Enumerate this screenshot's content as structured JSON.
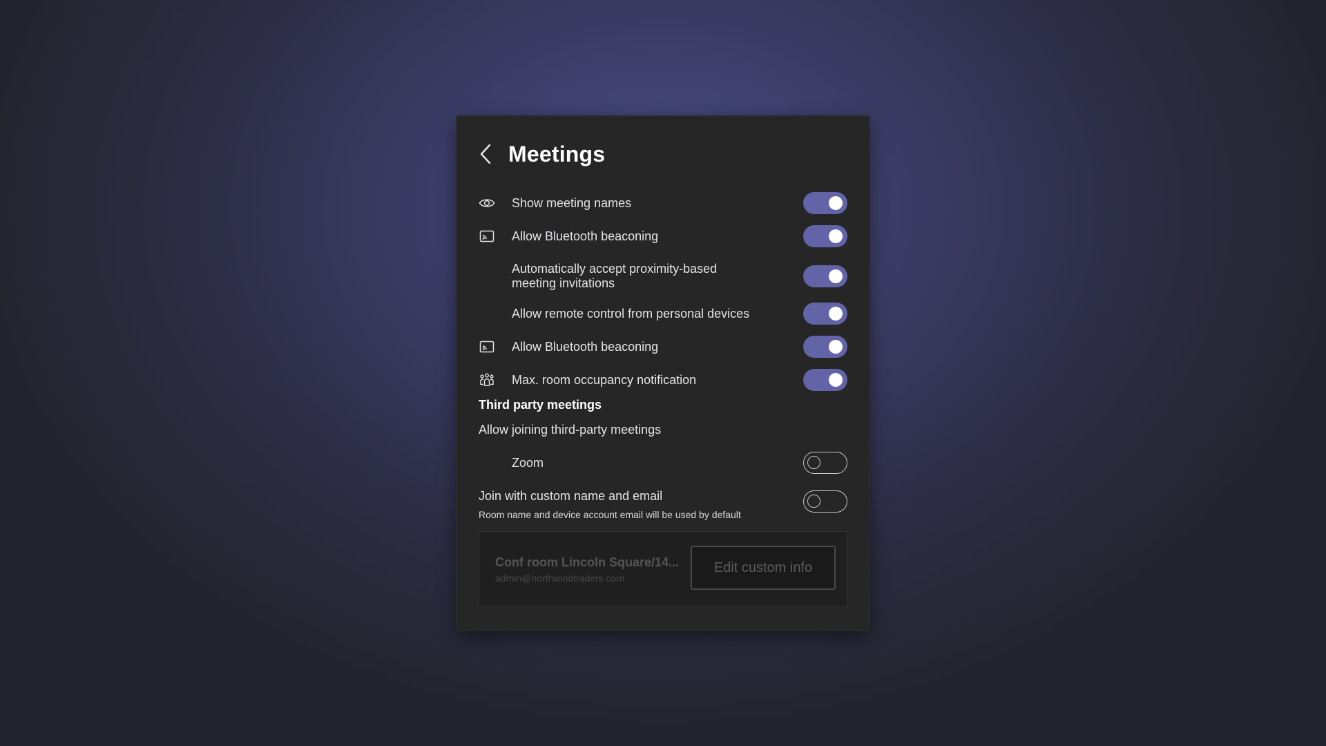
{
  "header": {
    "back_icon": "chevron-left-icon",
    "title": "Meetings"
  },
  "settings": [
    {
      "icon": "eye-icon",
      "label": "Show meeting names",
      "enabled": true
    },
    {
      "icon": "cast-icon",
      "label": "Allow Bluetooth beaconing",
      "enabled": true
    },
    {
      "icon": null,
      "label": "Automatically accept proximity-based meeting invitations",
      "label_line1": "Automatically accept proximity-based",
      "label_line2": "meeting invitations",
      "enabled": true
    },
    {
      "icon": null,
      "label": "Allow remote control from personal devices",
      "enabled": true
    },
    {
      "icon": "cast-icon",
      "label": "Allow Bluetooth beaconing",
      "enabled": true
    },
    {
      "icon": "people-group-icon",
      "label": "Max. room occupancy notification",
      "enabled": true
    }
  ],
  "third_party": {
    "section_title": "Third party meetings",
    "subtitle": "Allow joining third-party meetings",
    "zoom": {
      "label": "Zoom",
      "enabled": false
    },
    "custom_name": {
      "label": "Join with custom name and email",
      "hint": "Room name and device account email will be used by default",
      "enabled": false
    }
  },
  "custom_info": {
    "room_name": "Conf room Lincoln Square/14...",
    "email": "admin@northwindtraders.com",
    "edit_button_label": "Edit custom info"
  },
  "colors": {
    "accent": "#6264a7",
    "panel": "#272626",
    "background": "#3b3c66"
  }
}
